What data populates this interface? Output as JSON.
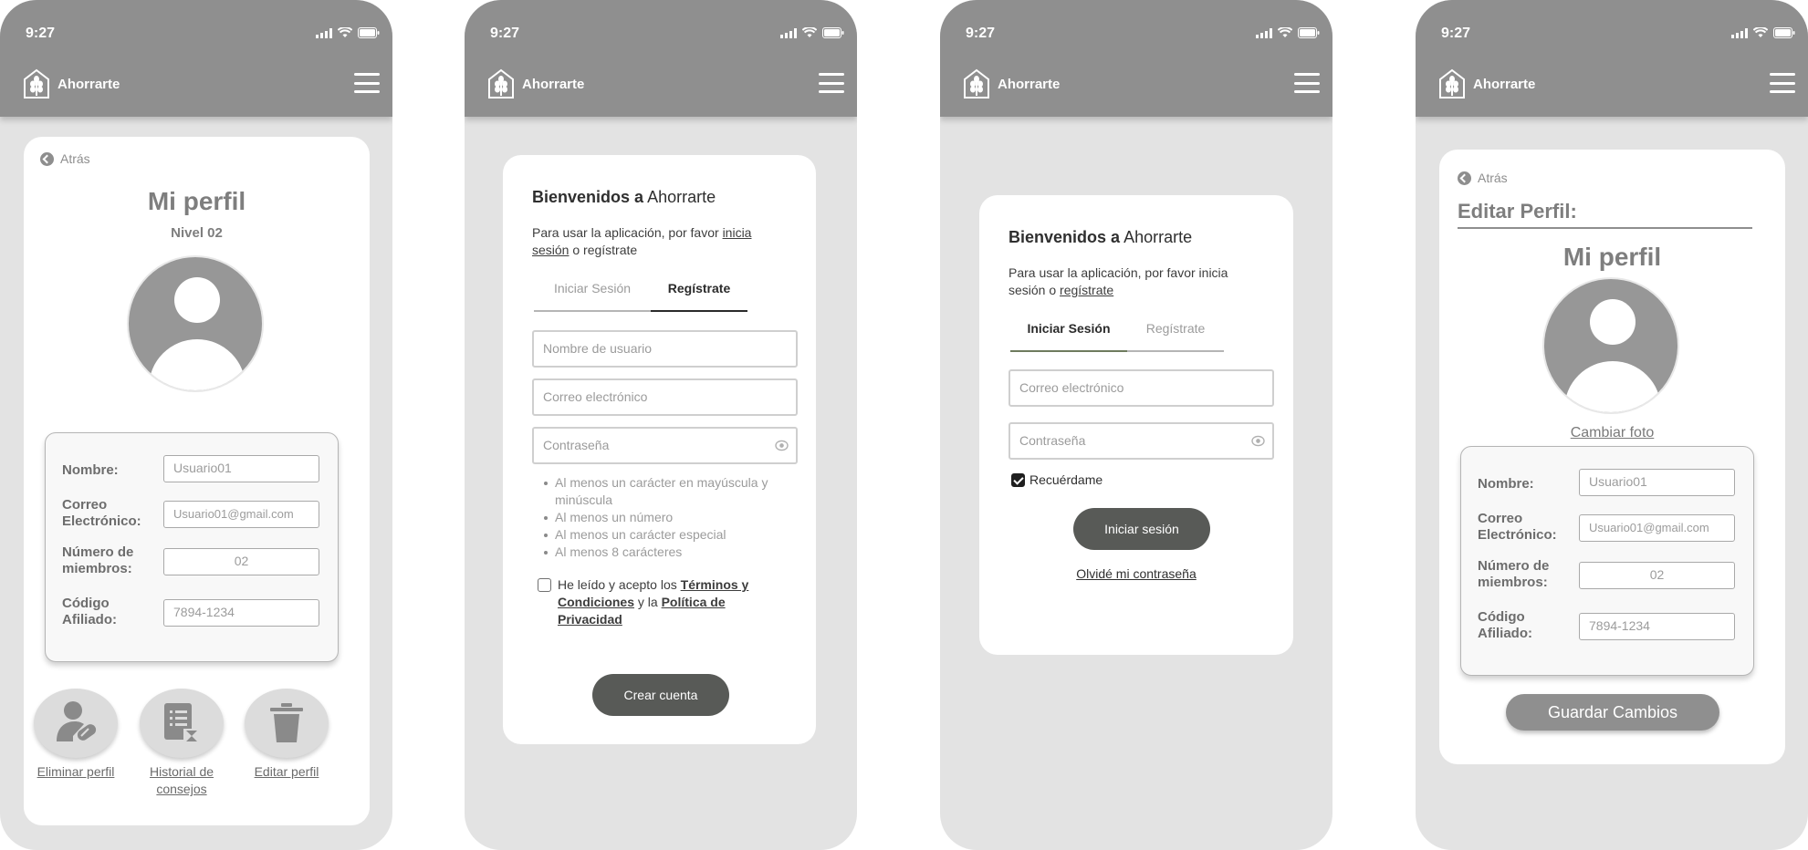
{
  "status_bar": {
    "time": "9:27"
  },
  "app": {
    "name": "Ahorrarte"
  },
  "screen_profile": {
    "back_label": "Atrás",
    "title": "Mi perfil",
    "level": "Nivel 02",
    "fields": [
      {
        "label": "Nombre:",
        "value": "Usuario01"
      },
      {
        "label": "Correo Electrónico:",
        "value": "Usuario01@gmail.com"
      },
      {
        "label": "Número de miembros:",
        "value": "02"
      },
      {
        "label": "Código Afiliado:",
        "value": "7894-1234"
      }
    ],
    "actions": [
      {
        "label": "Eliminar perfil",
        "icon": "delete-user-icon"
      },
      {
        "label": "Historial de consejos",
        "icon": "document-history-icon"
      },
      {
        "label": "Editar perfil",
        "icon": "trash-icon"
      }
    ]
  },
  "screen_register": {
    "welcome_bold": "Bienvenidos a",
    "welcome_rest": "Ahorrarte",
    "intro_a": "Para usar la aplicación, por favor ",
    "intro_link": "inicia sesión",
    "intro_b": " o regístrate",
    "tab_login": "Iniciar Sesión",
    "tab_register": "Regístrate",
    "username_placeholder": "Nombre de usuario",
    "email_placeholder": "Correo electrónico",
    "password_placeholder": "Contraseña",
    "rules": [
      "Al menos un carácter en mayúscula y minúscula",
      "Al menos un número",
      "Al menos un carácter especial",
      "Al menos 8 carácteres"
    ],
    "terms_a": "He leído y acepto los ",
    "terms_link1": "Términos y Condiciones",
    "terms_b": " y la ",
    "terms_link2": "Política de Privacidad",
    "create_button": "Crear cuenta"
  },
  "screen_login": {
    "welcome_bold": "Bienvenidos a",
    "welcome_rest": "Ahorrarte",
    "intro_a": "Para usar la aplicación, por favor inicia sesión o ",
    "intro_link": "regístrate",
    "tab_login": "Iniciar Sesión",
    "tab_register": "Regístrate",
    "email_placeholder": "Correo electrónico",
    "password_placeholder": "Contraseña",
    "remember_label": "Recuérdame",
    "login_button": "Iniciar sesión",
    "forgot_link": "Olvidé mi contraseña"
  },
  "screen_edit": {
    "back_label": "Atrás",
    "heading": "Editar Perfil:",
    "title": "Mi perfil",
    "change_photo": "Cambiar foto",
    "fields": [
      {
        "label": "Nombre:",
        "value": "Usuario01"
      },
      {
        "label": "Correo Electrónico:",
        "value": "Usuario01@gmail.com"
      },
      {
        "label": "Número de miembros:",
        "value": "02"
      },
      {
        "label": "Código Afiliado:",
        "value": "7894-1234"
      }
    ],
    "save_button": "Guardar Cambios"
  },
  "colors": {
    "header": "#8f8f8f",
    "background": "#e3e3e3",
    "dark_button": "#585a57",
    "grey_button": "#8f8f8f",
    "login_tab_underline": "#6e7b5e"
  }
}
